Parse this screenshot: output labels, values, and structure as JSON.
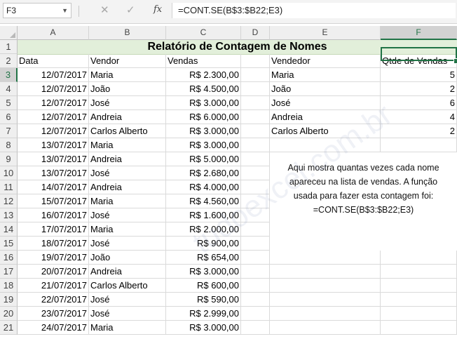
{
  "formula_bar": {
    "name_box": "F3",
    "formula": "=CONT.SE(B$3:$B22;E3)"
  },
  "columns": [
    "A",
    "B",
    "C",
    "D",
    "E",
    "F"
  ],
  "selected_cell": "F3",
  "title": "Relatório de Contagem de Nomes",
  "headers": {
    "data": "Data",
    "vendor": "Vendor",
    "vendas": "Vendas",
    "vendedor": "Vendedor",
    "qtde": "Qtde de Vendas"
  },
  "rows": [
    {
      "n": "3",
      "data": "12/07/2017",
      "vendor": "Maria",
      "vendas": "R$ 2.300,00"
    },
    {
      "n": "4",
      "data": "12/07/2017",
      "vendor": "João",
      "vendas": "R$ 4.500,00"
    },
    {
      "n": "5",
      "data": "12/07/2017",
      "vendor": "José",
      "vendas": "R$ 3.000,00"
    },
    {
      "n": "6",
      "data": "12/07/2017",
      "vendor": "Andreia",
      "vendas": "R$ 6.000,00"
    },
    {
      "n": "7",
      "data": "12/07/2017",
      "vendor": "Carlos Alberto",
      "vendas": "R$ 3.000,00"
    },
    {
      "n": "8",
      "data": "13/07/2017",
      "vendor": "Maria",
      "vendas": "R$ 3.000,00"
    },
    {
      "n": "9",
      "data": "13/07/2017",
      "vendor": "Andreia",
      "vendas": "R$ 5.000,00"
    },
    {
      "n": "10",
      "data": "13/07/2017",
      "vendor": "José",
      "vendas": "R$ 2.680,00"
    },
    {
      "n": "11",
      "data": "14/07/2017",
      "vendor": "Andreia",
      "vendas": "R$ 4.000,00"
    },
    {
      "n": "12",
      "data": "15/07/2017",
      "vendor": "Maria",
      "vendas": "R$ 4.560,00"
    },
    {
      "n": "13",
      "data": "16/07/2017",
      "vendor": "José",
      "vendas": "R$ 1.600,00"
    },
    {
      "n": "14",
      "data": "17/07/2017",
      "vendor": "Maria",
      "vendas": "R$ 2.000,00"
    },
    {
      "n": "15",
      "data": "18/07/2017",
      "vendor": "José",
      "vendas": "R$ 900,00"
    },
    {
      "n": "16",
      "data": "19/07/2017",
      "vendor": "João",
      "vendas": "R$ 654,00"
    },
    {
      "n": "17",
      "data": "20/07/2017",
      "vendor": "Andreia",
      "vendas": "R$ 3.000,00"
    },
    {
      "n": "18",
      "data": "21/07/2017",
      "vendor": "Carlos Alberto",
      "vendas": "R$ 600,00"
    },
    {
      "n": "19",
      "data": "22/07/2017",
      "vendor": "José",
      "vendas": "R$ 590,00"
    },
    {
      "n": "20",
      "data": "23/07/2017",
      "vendor": "José",
      "vendas": "R$ 2.999,00"
    },
    {
      "n": "21",
      "data": "24/07/2017",
      "vendor": "Maria",
      "vendas": "R$ 3.000,00"
    }
  ],
  "summary": [
    {
      "vendedor": "Maria",
      "qtde": "5"
    },
    {
      "vendedor": "João",
      "qtde": "2"
    },
    {
      "vendedor": "José",
      "qtde": "6"
    },
    {
      "vendedor": "Andreia",
      "qtde": "4"
    },
    {
      "vendedor": "Carlos Alberto",
      "qtde": "2"
    }
  ],
  "note": {
    "line1": "Aqui mostra quantas vezes cada nome",
    "line2": "apareceu na lista de vendas. A função",
    "line3": "usada para fazer esta contagem foi:",
    "line4": "=CONT.SE(B$3:$B22;E3)"
  },
  "watermark": "tudoexcel.com.br"
}
